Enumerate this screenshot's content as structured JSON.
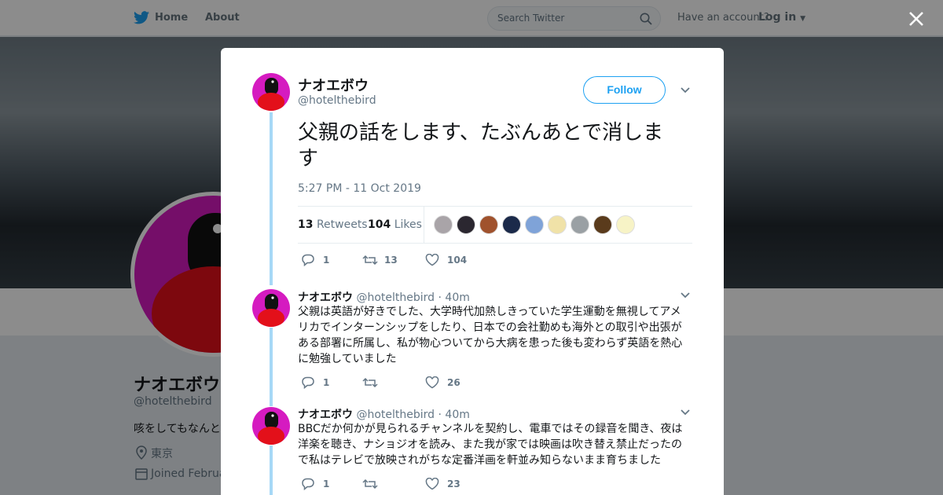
{
  "nav": {
    "home_label": "Home",
    "about_label": "About",
    "search_placeholder": "Search Twitter",
    "have_account": "Have an account?",
    "login_label": "Log in"
  },
  "background_profile": {
    "name": "ナオエボウ",
    "handle": "@hotelthebird",
    "bio": "咳をしてもなんと",
    "location": "東京",
    "joined": "Joined Februa"
  },
  "tweet": {
    "author_name": "ナオエボウ",
    "author_handle": "@hotelthebird",
    "follow_label": "Follow",
    "text": "父親の話をします、たぶんあとで消します",
    "timestamp": "5:27 PM - 11 Oct 2019",
    "retweets_count": "13",
    "retweets_label": "Retweets",
    "likes_count": "104",
    "likes_label": "Likes",
    "likers": [
      "#a9a4a8",
      "#2b2730",
      "#a0522d",
      "#1b2a4a",
      "#7fa3d8",
      "#f0e2a8",
      "#9aa0a4",
      "#5a3b1c",
      "#f7f3c6"
    ],
    "actions": {
      "replies": "1",
      "retweets": "13",
      "likes": "104"
    }
  },
  "replies": [
    {
      "name": "ナオエボウ",
      "handle": "@hotelthebird",
      "time": "40m",
      "lines": [
        "父親は英語が好きでした、大学時代加熱しきっていた学生運動を無視してアメ",
        "リカでインターンシップをしたり、日本での会社勤めも海外との取引や出張が",
        "ある部署に所属し、私が物心ついてから大病を患った後も変わらず英語を熱心",
        "に勉強していました"
      ],
      "replies": "1",
      "retweets": "",
      "likes": "26"
    },
    {
      "name": "ナオエボウ",
      "handle": "@hotelthebird",
      "time": "40m",
      "lines": [
        "BBCだか何かが見られるチャンネルを契約し、電車ではその録音を聞き、夜は",
        "洋楽を聴き、ナショジオを読み、また我が家では映画は吹き替え禁止だったの",
        "で私はテレビで放映されがちな定番洋画を軒並み知らないまま育ちました"
      ],
      "replies": "1",
      "retweets": "",
      "likes": "23"
    }
  ],
  "colors": {
    "accent": "#1da1f2",
    "avatar_bg": "#d51bc0",
    "thread_line": "#a6d8f6"
  }
}
